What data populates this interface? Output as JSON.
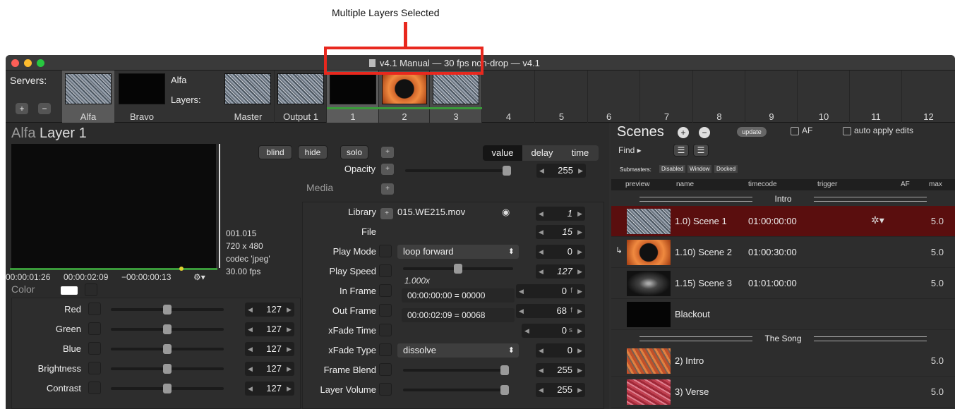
{
  "annotation": {
    "callout": "Multiple Layers Selected"
  },
  "window": {
    "title": "v4.1 Manual  —  30 fps non-drop  —  v4.1"
  },
  "servers": {
    "label": "Servers:",
    "add": "+",
    "remove": "−",
    "items": [
      {
        "label": "Alfa"
      },
      {
        "label": "Bravo"
      }
    ],
    "current_server": "Alfa",
    "layers_label": "Layers:"
  },
  "layers": {
    "items": [
      {
        "label": "Master"
      },
      {
        "label": "Output 1"
      },
      {
        "label": "1"
      },
      {
        "label": "2"
      },
      {
        "label": "3"
      },
      {
        "label": "4"
      },
      {
        "label": "5"
      },
      {
        "label": "6"
      },
      {
        "label": "7"
      },
      {
        "label": "8"
      },
      {
        "label": "9"
      },
      {
        "label": "10"
      },
      {
        "label": "11"
      },
      {
        "label": "12"
      }
    ]
  },
  "layer_panel": {
    "server": "Alfa",
    "layer": "Layer 1",
    "timecodes": {
      "elapsed": "00:00:01:26",
      "duration": "00:00:02:09",
      "remaining": "−00:00:00:13"
    },
    "info": {
      "clip": "001.015",
      "size": "720 x 480",
      "codec": "codec 'jpeg'",
      "fps": "30.00 fps"
    },
    "buttons": {
      "blind": "blind",
      "hide": "hide",
      "solo": "solo"
    },
    "tabs": {
      "value": "value",
      "delay": "delay",
      "time": "time",
      "active": "value"
    },
    "opacity": {
      "label": "Opacity",
      "value": "255",
      "level": 255,
      "max": 255
    },
    "media_label": "Media",
    "color": {
      "label": "Color",
      "params": [
        {
          "label": "Red",
          "value": "127",
          "level": 127
        },
        {
          "label": "Green",
          "value": "127",
          "level": 127
        },
        {
          "label": "Blue",
          "value": "127",
          "level": 127
        },
        {
          "label": "Brightness",
          "value": "127",
          "level": 127
        },
        {
          "label": "Contrast",
          "value": "127",
          "level": 127
        }
      ]
    },
    "media": {
      "library": {
        "label": "Library",
        "file": "015.WE215.mov",
        "value": "1"
      },
      "file": {
        "label": "File",
        "value": "15"
      },
      "play_mode": {
        "label": "Play Mode",
        "option": "loop forward",
        "value": "0"
      },
      "play_speed": {
        "label": "Play Speed",
        "display": "1.000x",
        "value": "127",
        "level": 127
      },
      "in_frame": {
        "label": "In Frame",
        "display": "00:00:00:00 = 00000",
        "value": "0",
        "unit": "f"
      },
      "out_frame": {
        "label": "Out Frame",
        "display": "00:00:02:09 = 00068",
        "value": "68",
        "unit": "f"
      },
      "xfade_time": {
        "label": "xFade Time",
        "value": "0",
        "unit": "s"
      },
      "xfade_type": {
        "label": "xFade Type",
        "option": "dissolve",
        "value": "0"
      },
      "frame_blend": {
        "label": "Frame Blend",
        "value": "255",
        "level": 255
      },
      "layer_volume": {
        "label": "Layer Volume",
        "value": "255",
        "level": 255
      }
    }
  },
  "scenes": {
    "title": "Scenes",
    "update": "update",
    "af_label": "AF",
    "auto_apply": "auto apply edits",
    "find": "Find",
    "submasters": {
      "label": "Submasters:",
      "options": [
        "Disabled",
        "Window",
        "Docked"
      ]
    },
    "columns": [
      "preview",
      "name",
      "timecode",
      "trigger",
      "AF",
      "max"
    ],
    "sections": [
      {
        "title": "Intro",
        "rows": [
          {
            "name": "1.0) Scene 1",
            "timecode": "01:00:00:00",
            "max": "5.0",
            "selected": true,
            "af": true
          },
          {
            "name": "1.10) Scene 2",
            "timecode": "01:00:30:00",
            "max": "5.0",
            "linked": true
          },
          {
            "name": "1.15) Scene 3",
            "timecode": "01:01:00:00",
            "max": "5.0"
          },
          {
            "name": "Blackout",
            "timecode": "",
            "max": ""
          }
        ]
      },
      {
        "title": "The Song",
        "rows": [
          {
            "name": "2) Intro",
            "timecode": "",
            "max": "5.0"
          },
          {
            "name": "3) Verse",
            "timecode": "",
            "max": "5.0"
          }
        ]
      }
    ]
  },
  "colors": {
    "selection_red": "#e8281e",
    "scene_selected": "#5a0e0e",
    "layer_selected_bar": "#3a9a3a"
  }
}
